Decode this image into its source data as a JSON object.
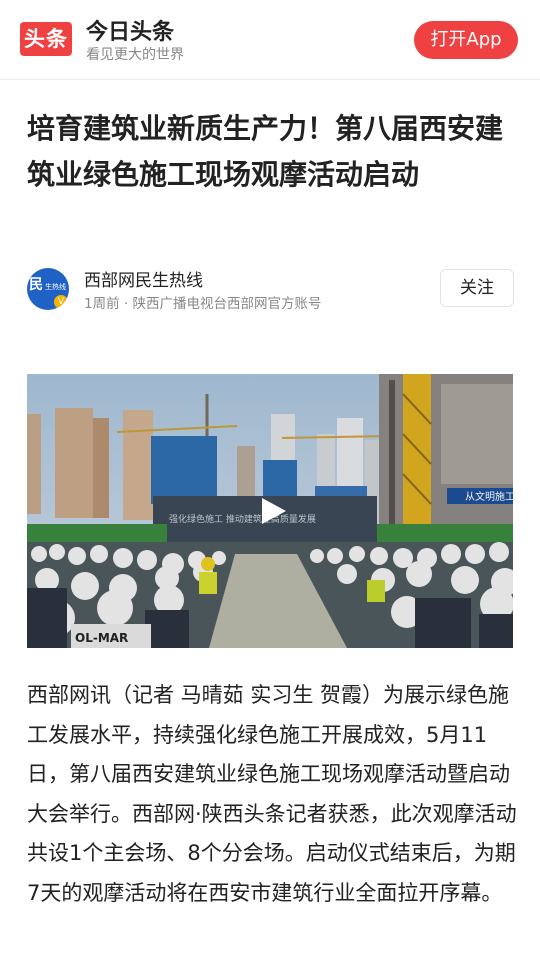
{
  "header": {
    "logo_text": "头条",
    "app_name": "今日头条",
    "slogan": "看见更大的世界",
    "open_app_label": "打开App",
    "brand_color": "#f04142"
  },
  "article": {
    "title": "培育建筑业新质生产力！第八届西安建筑业绿色施工现场观摩活动启动",
    "author": {
      "name": "西部网民生热线",
      "meta": "1周前 · 陕西广播电视台西部网官方账号",
      "avatar_text": "民",
      "avatar_small_text": "生热线",
      "badge": "V",
      "follow_label": "关注"
    },
    "video": {
      "banner_text": "从文明施工",
      "poster_text": "强化绿色施工 推动建筑业高质量发展",
      "shirt_text": "OL-MAR"
    },
    "body": "西部网讯（记者 马晴茹 实习生 贺霞）为展示绿色施工发展水平，持续强化绿色施工开展成效，5月11日，第八届西安建筑业绿色施工现场观摩活动暨启动大会举行。西部网·陕西头条记者获悉，此次观摩活动共设1个主会场、8个分会场。启动仪式结束后，为期7天的观摩活动将在西安市建筑行业全面拉开序幕。"
  }
}
